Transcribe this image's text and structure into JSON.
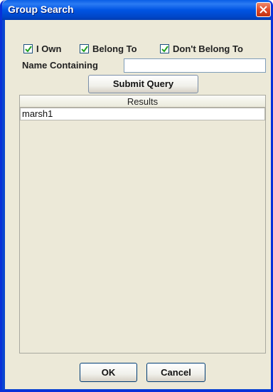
{
  "window": {
    "title": "Group Search"
  },
  "filters": [
    {
      "label": "I Own",
      "checked": true
    },
    {
      "label": "Belong To",
      "checked": true
    },
    {
      "label": "Don't Belong To",
      "checked": true
    }
  ],
  "name_filter": {
    "label": "Name Containing",
    "value": ""
  },
  "buttons": {
    "submit": "Submit Query",
    "ok": "OK",
    "cancel": "Cancel"
  },
  "results": {
    "header": "Results",
    "rows": [
      "marsh1"
    ]
  }
}
